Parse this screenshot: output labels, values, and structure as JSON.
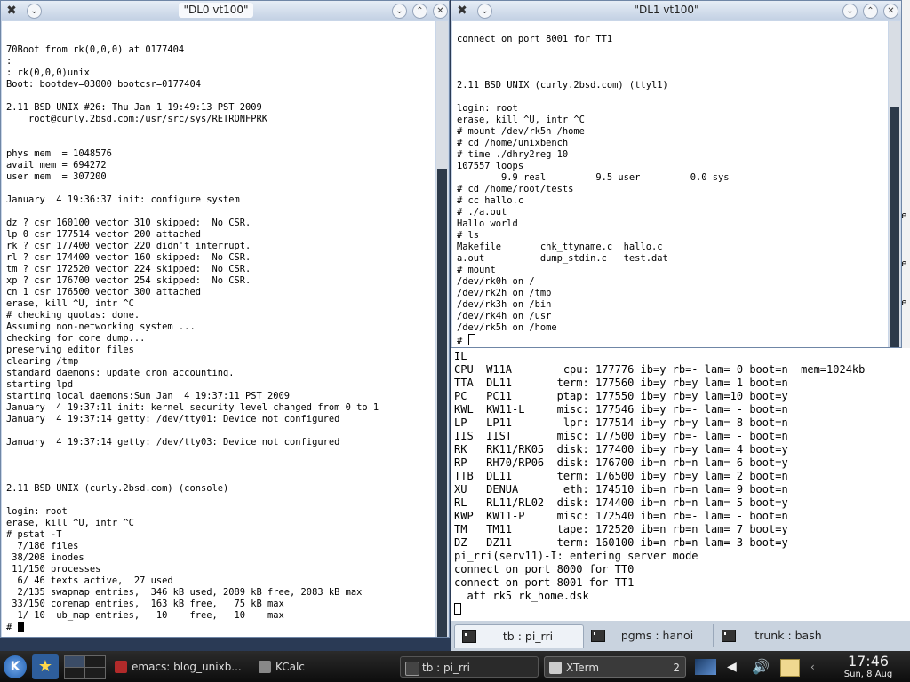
{
  "left_window": {
    "title": "\"DL0 vt100\"",
    "lines": [
      "",
      "",
      "70Boot from rk(0,0,0) at 0177404",
      ":",
      ": rk(0,0,0)unix",
      "Boot: bootdev=03000 bootcsr=0177404",
      "",
      "2.11 BSD UNIX #26: Thu Jan 1 19:49:13 PST 2009",
      "    root@curly.2bsd.com:/usr/src/sys/RETRONFPRK",
      "",
      "",
      "phys mem  = 1048576",
      "avail mem = 694272",
      "user mem  = 307200",
      "",
      "January  4 19:36:37 init: configure system",
      "",
      "dz ? csr 160100 vector 310 skipped:  No CSR.",
      "lp 0 csr 177514 vector 200 attached",
      "rk ? csr 177400 vector 220 didn't interrupt.",
      "rl ? csr 174400 vector 160 skipped:  No CSR.",
      "tm ? csr 172520 vector 224 skipped:  No CSR.",
      "xp ? csr 176700 vector 254 skipped:  No CSR.",
      "cn 1 csr 176500 vector 300 attached",
      "erase, kill ^U, intr ^C",
      "# checking quotas: done.",
      "Assuming non-networking system ...",
      "checking for core dump...",
      "preserving editor files",
      "clearing /tmp",
      "standard daemons: update cron accounting.",
      "starting lpd",
      "starting local daemons:Sun Jan  4 19:37:11 PST 2009",
      "January  4 19:37:11 init: kernel security level changed from 0 to 1",
      "January  4 19:37:14 getty: /dev/tty01: Device not configured",
      "",
      "January  4 19:37:14 getty: /dev/tty03: Device not configured",
      "",
      "",
      "",
      "2.11 BSD UNIX (curly.2bsd.com) (console)",
      "",
      "login: root",
      "erase, kill ^U, intr ^C",
      "# pstat -T",
      "  7/186 files",
      " 38/208 inodes",
      " 11/150 processes",
      "  6/ 46 texts active,  27 used",
      "  2/135 swapmap entries,  346 kB used, 2089 kB free, 2083 kB max",
      " 33/150 coremap entries,  163 kB free,   75 kB max",
      "  1/ 10  ub_map entries,   10    free,   10    max"
    ],
    "prompt": "# "
  },
  "right_window": {
    "title": "\"DL1 vt100\"",
    "lines": [
      "connect on port 8001 for TT1",
      "",
      "",
      "",
      "2.11 BSD UNIX (curly.2bsd.com) (ttyl1)",
      "",
      "login: root",
      "erase, kill ^U, intr ^C",
      "# mount /dev/rk5h /home",
      "# cd /home/unixbench",
      "# time ./dhry2reg 10",
      "107557 loops",
      "        9.9 real         9.5 user         0.0 sys",
      "# cd /home/root/tests",
      "# cc hallo.c",
      "# ./a.out",
      "Hallo world",
      "# ls",
      "Makefile       chk_ttyname.c  hallo.c",
      "a.out          dump_stdin.c   test.dat",
      "# mount",
      "/dev/rk0h on /",
      "/dev/rk2h on /tmp",
      "/dev/rk3h on /bin",
      "/dev/rk4h on /usr",
      "/dev/rk5h on /home"
    ],
    "prompt": "# "
  },
  "konsole": {
    "lines": [
      "IL",
      "CPU  W11A        cpu: 177776 ib=y rb=- lam= 0 boot=n  mem=1024kb",
      "TTA  DL11       term: 177560 ib=y rb=y lam= 1 boot=n",
      "PC   PC11       ptap: 177550 ib=y rb=y lam=10 boot=y",
      "KWL  KW11-L     misc: 177546 ib=y rb=- lam= - boot=n",
      "LP   LP11        lpr: 177514 ib=y rb=y lam= 8 boot=n",
      "IIS  IIST       misc: 177500 ib=y rb=- lam= - boot=n",
      "RK   RK11/RK05  disk: 177400 ib=y rb=y lam= 4 boot=y",
      "RP   RH70/RP06  disk: 176700 ib=n rb=n lam= 6 boot=y",
      "TTB  DL11       term: 176500 ib=y rb=y lam= 2 boot=n",
      "XU   DENUA       eth: 174510 ib=n rb=n lam= 9 boot=n",
      "RL   RL11/RL02  disk: 174400 ib=n rb=n lam= 5 boot=y",
      "KWP  KW11-P     misc: 172540 ib=n rb=- lam= - boot=n",
      "TM   TM11       tape: 172520 ib=n rb=n lam= 7 boot=y",
      "DZ   DZ11       term: 160100 ib=n rb=n lam= 3 boot=y",
      "pi_rri(serv11)-I: entering server mode",
      "connect on port 8000 for TT0",
      "connect on port 8001 for TT1",
      "  att rk5 rk_home.dsk"
    ],
    "tabs": [
      {
        "label": "tb : pi_rri"
      },
      {
        "label": "pgms : hanoi"
      },
      {
        "label": "trunk : bash"
      }
    ]
  },
  "taskbar": {
    "tasks": [
      {
        "label": "emacs: blog_unixb..."
      },
      {
        "label": "KCalc"
      },
      {
        "label": "tb : pi_rri"
      },
      {
        "label": "XTerm"
      }
    ],
    "xterm_count": "2",
    "clock_time": "17:46",
    "clock_date": "Sun, 8 Aug"
  },
  "colors": {
    "desktop": "#2a3a55",
    "titlebar": "#c9d6e8",
    "terminal_bg": "#ffffff",
    "scroll_thumb": "#2d3a4a"
  }
}
